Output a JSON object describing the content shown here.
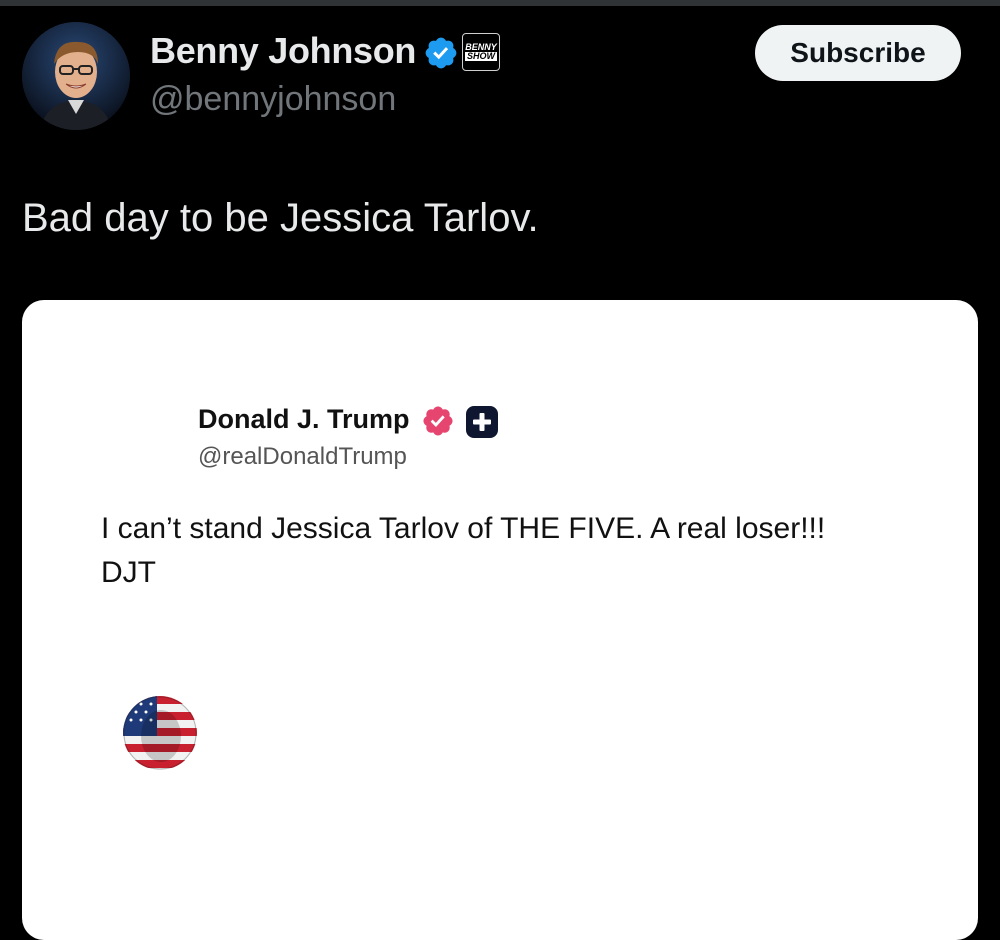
{
  "author": {
    "display_name": "Benny Johnson",
    "handle": "@bennyjohnson",
    "verified_icon": "verified-badge-icon",
    "affiliate_badge": [
      "BENNY",
      "SHOW"
    ]
  },
  "actions": {
    "subscribe_label": "Subscribe"
  },
  "post": {
    "text": "Bad day to be Jessica Tarlov."
  },
  "embedded_post": {
    "display_name": "Donald J. Trump",
    "handle": "@realDonaldTrump",
    "text": "I can’t stand Jessica Tarlov of THE FIVE. A real loser!!! DJT"
  },
  "colors": {
    "background": "#000000",
    "verified_blue": "#1d9bf0",
    "embed_verified_pink": "#e5456f"
  }
}
